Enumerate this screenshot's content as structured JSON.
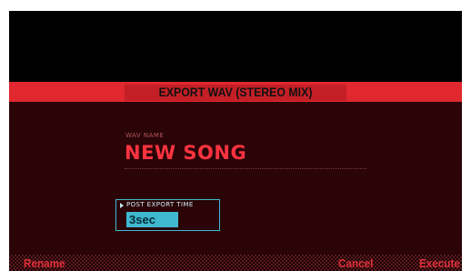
{
  "title": "EXPORT WAV (STEREO MIX)",
  "wav_name": {
    "label": "WAV NAME",
    "value": "NEW SONG"
  },
  "post_export_time": {
    "label": "POST EXPORT TIME",
    "value": "3sec",
    "selected": true
  },
  "function_buttons": {
    "rename": "Rename",
    "cancel": "Cancel",
    "execute": "Execute"
  },
  "colors": {
    "title_bar": "#e0282e",
    "content_bg": "#2a0407",
    "name_text": "#ff3340",
    "cursor": "#3fb8d0",
    "function_text": "#e0303a"
  },
  "icons": {
    "cursor_marker": "triangle-right-icon"
  }
}
